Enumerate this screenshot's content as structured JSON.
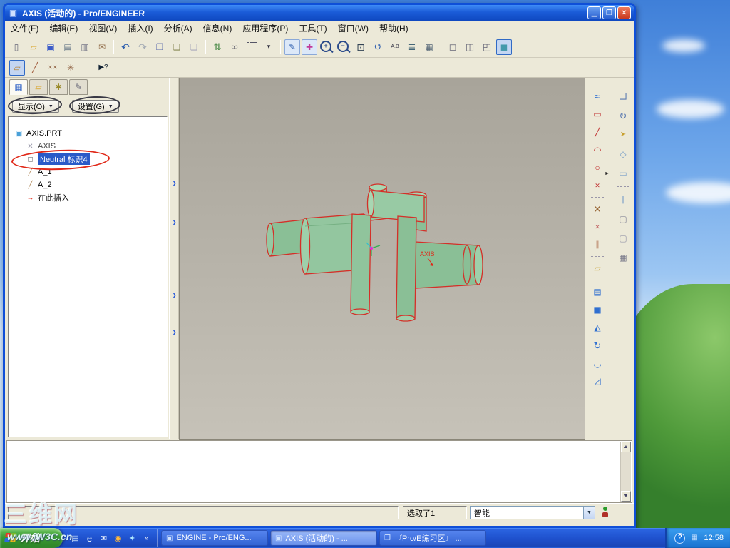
{
  "window": {
    "title": "AXIS (活动的) - Pro/ENGINEER",
    "menu_items": [
      "文件(F)",
      "编辑(E)",
      "视图(V)",
      "插入(I)",
      "分析(A)",
      "信息(N)",
      "应用程序(P)",
      "工具(T)",
      "窗口(W)",
      "帮助(H)"
    ],
    "app_icon_glyph": "▣",
    "caption_buttons": {
      "minimize": "▁",
      "restore": "❐",
      "close": "✕"
    }
  },
  "toolbar_main": [
    {
      "name": "new-file-icon",
      "glyph": "▯",
      "color": "#667"
    },
    {
      "name": "open-folder-icon",
      "glyph": "▱",
      "color": "#d8a01c"
    },
    {
      "name": "save-icon",
      "glyph": "▣",
      "color": "#3b5bc8"
    },
    {
      "name": "print-icon",
      "glyph": "▤",
      "color": "#667788"
    },
    {
      "name": "print-preview-icon",
      "glyph": "▥",
      "color": "#778"
    },
    {
      "name": "email-icon",
      "glyph": "✉",
      "color": "#997755"
    },
    {
      "type": "sep"
    },
    {
      "name": "undo-icon",
      "glyph": "↶",
      "color": "#2f5fae",
      "fs": 14
    },
    {
      "name": "redo-icon",
      "glyph": "↷",
      "color": "#a8aeb6",
      "fs": 14
    },
    {
      "name": "copy-icon",
      "glyph": "❐",
      "color": "#5566aa"
    },
    {
      "name": "paste-icon",
      "glyph": "❑",
      "color": "#888855"
    },
    {
      "name": "paste-special-icon",
      "glyph": "❏",
      "color": "#aaaabb"
    },
    {
      "type": "sep"
    },
    {
      "name": "regenerate-icon",
      "glyph": "⇅",
      "color": "#2f7a2f",
      "fs": 13
    },
    {
      "name": "find-icon",
      "glyph": "∞",
      "color": "#444455",
      "fs": 13
    },
    {
      "name": "selection-filter-icon",
      "css": "dashbox"
    },
    {
      "name": "filter-caret-icon",
      "glyph": "▾",
      "color": "#223",
      "fs": 9
    },
    {
      "type": "sep"
    },
    {
      "name": "repaint-icon",
      "glyph": "✎",
      "color": "#2f5fae",
      "boxed": true
    },
    {
      "name": "spin-center-icon",
      "glyph": "✚",
      "color": "#c03a9a",
      "boxed": true
    },
    {
      "name": "zoom-in-icon",
      "css": "mag",
      "g": "+"
    },
    {
      "name": "zoom-out-icon",
      "css": "mag",
      "g": "−"
    },
    {
      "name": "zoom-fit-icon",
      "glyph": "⊡",
      "color": "#334455",
      "fs": 14
    },
    {
      "name": "reorient-icon",
      "glyph": "↺",
      "color": "#2f5fae",
      "fs": 13
    },
    {
      "name": "saved-views-icon",
      "glyph": "A.B",
      "color": "#334",
      "fs": 7
    },
    {
      "name": "layers-icon",
      "glyph": "≣",
      "color": "#446677",
      "fs": 13
    },
    {
      "name": "view-manager-icon",
      "glyph": "▦",
      "color": "#556677"
    },
    {
      "type": "sep"
    },
    {
      "name": "wireframe-display-icon",
      "glyph": "◻",
      "color": "#667",
      "fs": 13
    },
    {
      "name": "hidden-line-display-icon",
      "glyph": "◫",
      "color": "#667",
      "fs": 13
    },
    {
      "name": "no-hidden-display-icon",
      "glyph": "◰",
      "color": "#667",
      "fs": 13
    },
    {
      "name": "shaded-display-icon",
      "glyph": "◼",
      "color": "#4499aa",
      "fs": 13,
      "pressed": true
    }
  ],
  "toolbar_datum": [
    {
      "name": "datum-plane-icon",
      "glyph": "▱",
      "color": "#b8863a",
      "pressed": true
    },
    {
      "name": "datum-axis-icon",
      "glyph": "╱",
      "color": "#a05a3a",
      "fs": 13
    },
    {
      "name": "datum-point-icon",
      "glyph": "✕✕",
      "color": "#8a5a3a",
      "fs": 8
    },
    {
      "name": "datum-csys-icon",
      "glyph": "✳",
      "color": "#8a5a3a",
      "fs": 12
    },
    {
      "type": "gap"
    },
    {
      "name": "context-help-icon",
      "glyph": "▶?",
      "color": "#112233",
      "fs": 10
    }
  ],
  "nav_panel": {
    "tabs": [
      {
        "name": "model-tree-tab",
        "glyph": "▦",
        "color": "#3a6ac8",
        "css": "tab tabactive"
      },
      {
        "name": "layer-tree-tab",
        "glyph": "▱",
        "color": "#d8a01c",
        "css": "tab"
      },
      {
        "name": "rules-display-tab",
        "glyph": "✱",
        "color": "#9a8a2a",
        "css": "tab"
      },
      {
        "name": "annotate-tab",
        "glyph": "✎",
        "color": "#667",
        "css": "tab"
      }
    ],
    "display_button": "显示(O)",
    "settings_button": "设置(G)"
  },
  "tree": {
    "items": [
      {
        "label": "AXIS.PRT",
        "icon": "▣"
      },
      {
        "label": "AXIS",
        "icon": "✕",
        "struck": true
      },
      {
        "label": "Neutral 标识4",
        "icon": "◻",
        "selected": true
      },
      {
        "label": "A_1",
        "icon": "╱"
      },
      {
        "label": "A_2",
        "icon": "╱"
      },
      {
        "label": "在此插入",
        "icon": "→"
      }
    ]
  },
  "viewport": {
    "model_label": "AXIS"
  },
  "right_toolbar": [
    {
      "name": "style-curve-icon",
      "glyph": "≈",
      "color": "#2f6fd0",
      "fs": 14
    },
    {
      "name": "rectangle-tool-icon",
      "glyph": "▭",
      "color": "#c03030"
    },
    {
      "name": "line-tool-icon",
      "glyph": "╱",
      "color": "#c03030"
    },
    {
      "name": "arc-tool-icon",
      "glyph": "◠",
      "color": "#c03030",
      "fs": 13
    },
    {
      "name": "circle-tool-icon",
      "glyph": "○",
      "color": "#c03030",
      "fs": 12
    },
    {
      "name": "point-tool-icon",
      "glyph": "✕",
      "color": "#c03030",
      "fs": 9
    },
    {
      "type": "sep"
    },
    {
      "name": "construction-x-icon",
      "glyph": "✕",
      "color": "#9a6a3a",
      "fs": 14
    },
    {
      "name": "axis-point-icon",
      "glyph": "✕",
      "color": "#c06060",
      "fs": 9
    },
    {
      "name": "offset-lines-icon",
      "glyph": "∥",
      "color": "#b07050",
      "fs": 11
    },
    {
      "type": "sep"
    },
    {
      "name": "palette-icon",
      "glyph": "▱",
      "color": "#c8a030"
    },
    {
      "type": "sep"
    },
    {
      "name": "fill-tool-icon",
      "glyph": "▤",
      "color": "#2f6fd0"
    },
    {
      "name": "section-tool-icon",
      "glyph": "▣",
      "color": "#2f6fd0"
    },
    {
      "name": "mirror-tool-icon",
      "glyph": "◭",
      "color": "#2f6fd0"
    },
    {
      "name": "rotate-tool-icon",
      "glyph": "↻",
      "color": "#2f6fd0",
      "fs": 13
    },
    {
      "name": "blend-arc-icon",
      "glyph": "◡",
      "color": "#2f6fd0",
      "fs": 13
    },
    {
      "name": "chamfer-tool-icon",
      "glyph": "◿",
      "color": "#2f6fd0"
    }
  ],
  "far_right_toolbar": [
    {
      "name": "copy-geometry-icon",
      "glyph": "❑",
      "color": "#5a7ab0"
    },
    {
      "name": "rotate-view-icon",
      "glyph": "↻",
      "color": "#5a7ab0",
      "fs": 13
    },
    {
      "name": "select-arrow-icon",
      "glyph": "➤",
      "color": "#c8a030",
      "fs": 10
    },
    {
      "name": "surface-tool-icon",
      "glyph": "◇",
      "color": "#7aa0c8",
      "fs": 12
    },
    {
      "name": "boundary-tool-icon",
      "glyph": "▭",
      "color": "#7aa0c8"
    },
    {
      "type": "sep"
    },
    {
      "name": "pattern-tool-icon",
      "glyph": "∥",
      "color": "#7aa0c8",
      "fs": 11
    },
    {
      "name": "sketch-tool-icon",
      "glyph": "▢",
      "color": "#888899"
    },
    {
      "name": "plane-tool-icon",
      "glyph": "▢",
      "color": "#9999aa"
    },
    {
      "name": "palette-grid-icon",
      "glyph": "▦",
      "color": "#778"
    }
  ],
  "ui": {
    "splitter_chevron": "❯",
    "flyout_arrow": "►",
    "scroll_up": "▲",
    "scroll_down": "▼",
    "combo_caret": "▼",
    "dropdown_caret": "▼"
  },
  "status_bar": {
    "selected_text": "选取了1",
    "filter_value": "智能"
  },
  "taskbar": {
    "start_label": "开始",
    "quick_launch": [
      {
        "name": "show-desktop-icon",
        "glyph": "▤",
        "color": "#d8ecff"
      },
      {
        "name": "ie-icon",
        "glyph": "e",
        "color": "#eaf6ff",
        "fs": 13
      },
      {
        "name": "outlook-icon",
        "glyph": "✉",
        "color": "#f0f6ff"
      },
      {
        "name": "media-player-icon",
        "glyph": "◉",
        "color": "#ffb83a"
      },
      {
        "name": "messenger-icon",
        "glyph": "✦",
        "color": "#aee8ff"
      },
      {
        "name": "qlaunch-chevron-icon",
        "glyph": "»",
        "color": "#ffffff",
        "fs": 10
      }
    ],
    "buttons": [
      {
        "label": "ENGINE - Pro/ENG...",
        "icon": "▣"
      },
      {
        "label": "AXIS (活动的) - ...",
        "icon": "▣"
      },
      {
        "label": "『Pro/E练习区』 ...",
        "icon": "❒"
      }
    ],
    "tray_icons": [
      {
        "name": "tray-help-icon",
        "glyph": "?",
        "css": "trayhelp",
        "fs": 10
      },
      {
        "name": "tray-device-icon",
        "glyph": "▦",
        "color": "#cfe4ff"
      }
    ],
    "clock": "12:58"
  },
  "watermark": {
    "line1": "三维网",
    "line2": "www.iW3C.cn"
  },
  "accent_colors": {
    "selection": "#2a5ac8",
    "model_edge": "#d42f28",
    "model_fill": "#8fc39b",
    "annotation_red": "#e02818"
  }
}
